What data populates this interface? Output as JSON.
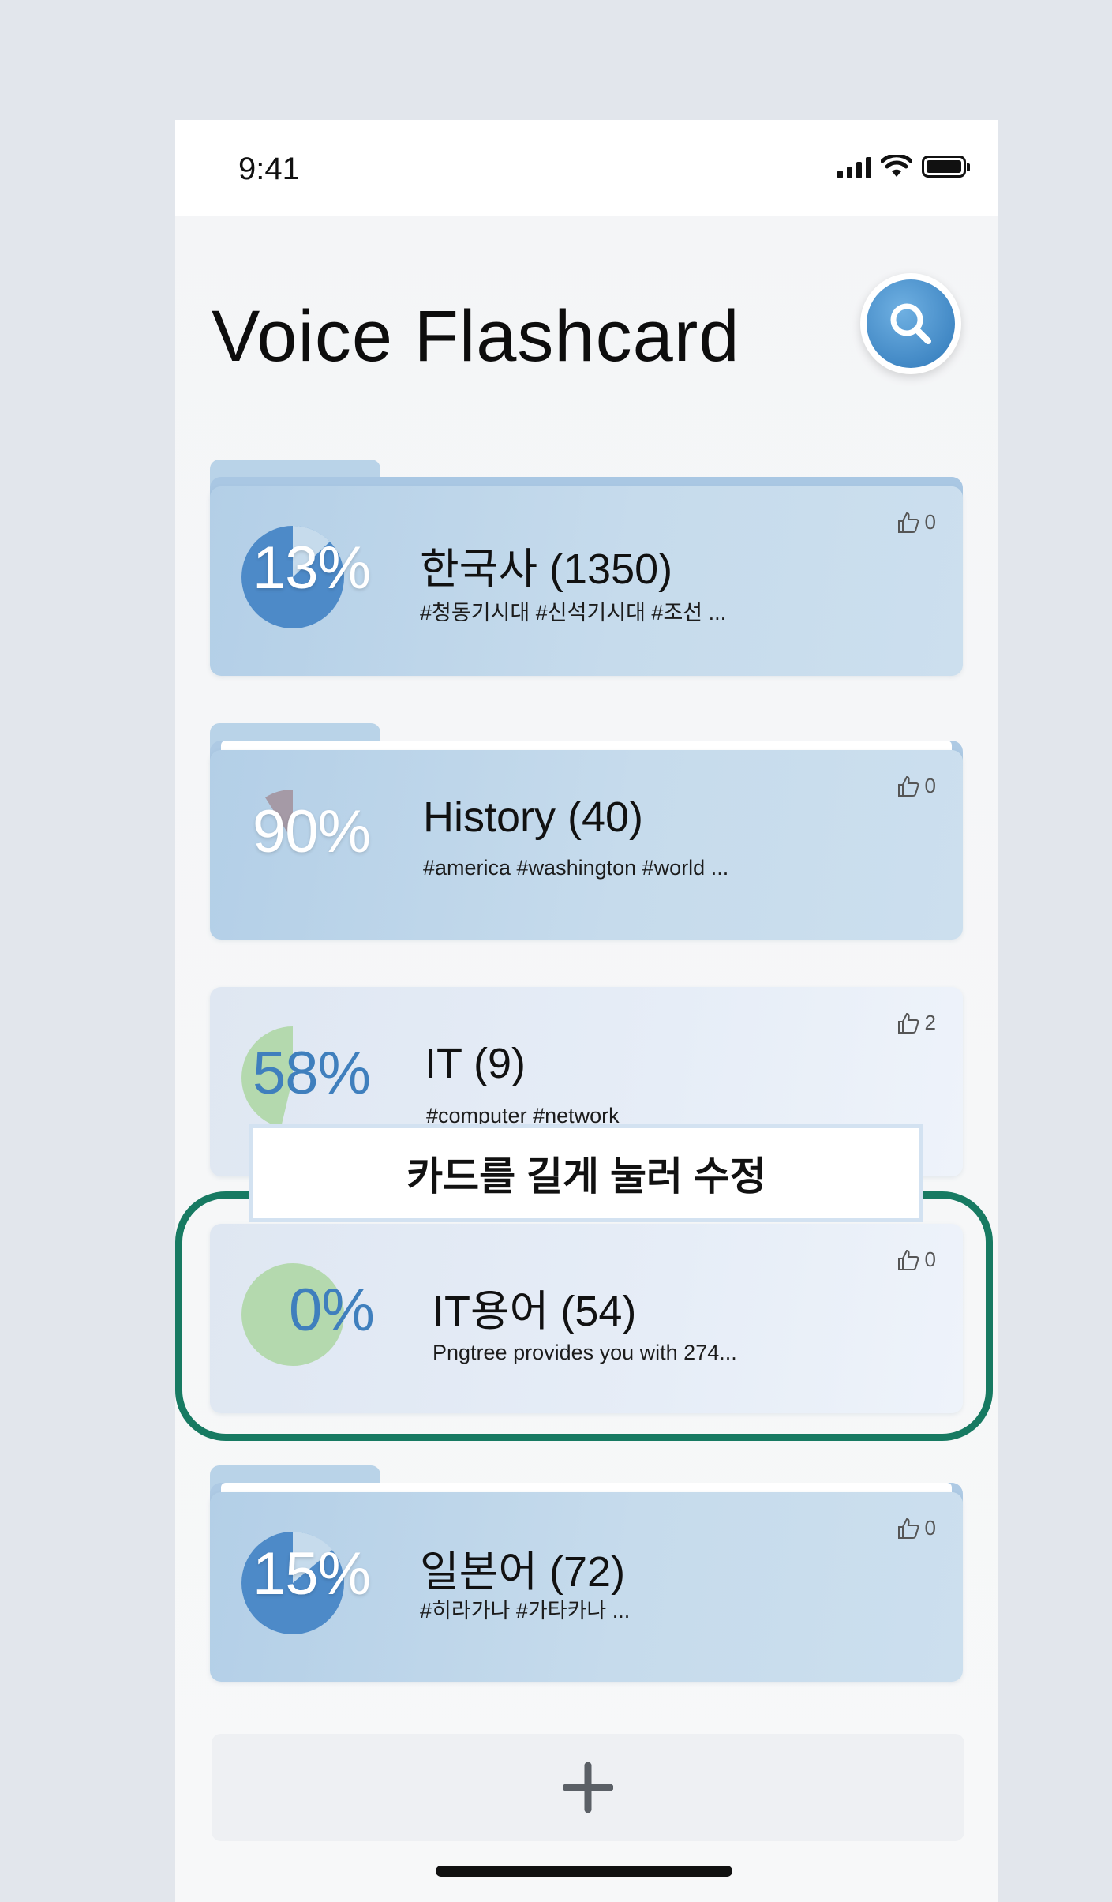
{
  "status": {
    "time": "9:41"
  },
  "header": {
    "title": "Voice Flashcard"
  },
  "cards": [
    {
      "percent": "13%",
      "progress": 0.13,
      "title": "한국사 (1350)",
      "tags": "#청동기시대 #신석기시대 #조선 ...",
      "likes": "0"
    },
    {
      "percent": "90%",
      "progress": 0.9,
      "title": "History (40)",
      "tags": "#america #washington #world ...",
      "likes": "0"
    },
    {
      "percent": "58%",
      "progress": 0.58,
      "title": "IT (9)",
      "tags": "#computer #network",
      "likes": "2"
    },
    {
      "percent": "0%",
      "progress": 0.0,
      "title": "IT용어 (54)",
      "tags": "Pngtree provides you with 274...",
      "likes": "0"
    },
    {
      "percent": "15%",
      "progress": 0.15,
      "title": "일본어 (72)",
      "tags": "#히라가나 #가타카나 ...",
      "likes": "0"
    }
  ],
  "tooltip": {
    "text": "카드를 길게 눌러 수정"
  },
  "colors": {
    "highlight": "#177a62",
    "accent_blue": "#3f7fbd",
    "green": "#a9d39f"
  },
  "icons": {
    "search": "search-icon",
    "like": "thumbs-up-icon",
    "add": "plus-icon"
  }
}
